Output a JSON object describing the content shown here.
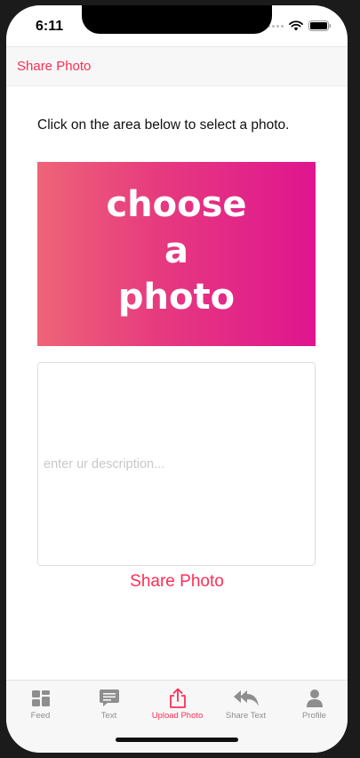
{
  "status_bar": {
    "time": "6:11"
  },
  "nav": {
    "title": "Share Photo"
  },
  "main": {
    "instruction": "Click on the area below to select a photo.",
    "photo_picker": {
      "lines": [
        "choose",
        "a",
        "photo"
      ],
      "gradient_start": "#ee6477",
      "gradient_end": "#df158f"
    },
    "description": {
      "placeholder": "enter ur description...",
      "value": ""
    },
    "share_button_label": "Share Photo"
  },
  "tab_bar": {
    "accent_color": "#ff2d55",
    "inactive_color": "#8e8e8e",
    "tabs": [
      {
        "label": "Feed",
        "icon": "grid-icon",
        "active": false
      },
      {
        "label": "Text",
        "icon": "message-icon",
        "active": false
      },
      {
        "label": "Upload Photo",
        "icon": "share-upload-icon",
        "active": true
      },
      {
        "label": "Share Text",
        "icon": "reply-all-icon",
        "active": false
      },
      {
        "label": "Profile",
        "icon": "person-icon",
        "active": false
      }
    ]
  }
}
